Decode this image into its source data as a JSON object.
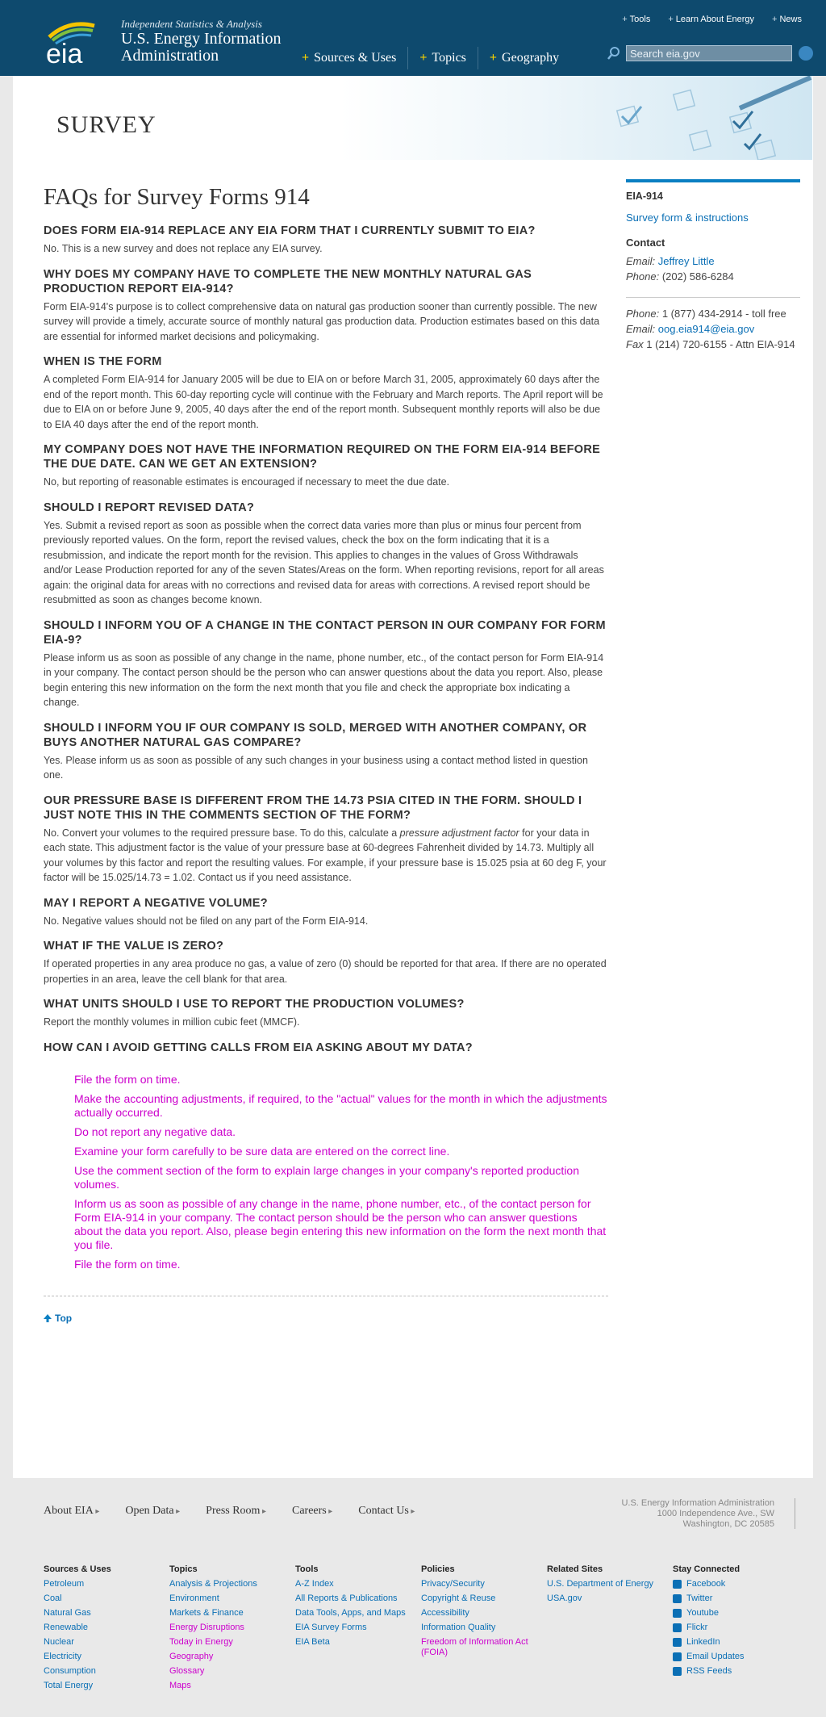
{
  "header": {
    "tagline": "Independent Statistics & Analysis",
    "agency_line1": "U.S. Energy Information",
    "agency_line2": "Administration",
    "logo_text": "eia",
    "utility": [
      "Tools",
      "Learn About Energy",
      "News"
    ],
    "nav": [
      "Sources & Uses",
      "Topics",
      "Geography"
    ],
    "search_placeholder": "Search eia.gov"
  },
  "banner": {
    "title": "SURVEY"
  },
  "page": {
    "title": "FAQs for Survey Forms 914",
    "faqs": [
      {
        "q": "DOES FORM EIA-914 REPLACE ANY EIA FORM THAT I CURRENTLY SUBMIT TO EIA?",
        "a": "No. This is a new survey and does not replace any EIA survey."
      },
      {
        "q": "WHY DOES MY COMPANY HAVE TO COMPLETE THE NEW MONTHLY NATURAL GAS PRODUCTION REPORT EIA-914?",
        "a": "Form EIA-914's purpose is to collect comprehensive data on natural gas production sooner than currently possible. The new survey will provide a timely, accurate source of monthly natural gas production data. Production estimates based on this data are essential for informed market decisions and policymaking."
      },
      {
        "q": "WHEN IS THE FORM",
        "a": "A completed Form EIA-914 for January 2005 will be due to EIA on or before March 31, 2005, approximately 60 days after the end of the report month. This 60-day reporting cycle will continue with the February and March reports. The April report will be due to EIA on or before June 9, 2005, 40 days after the end of the report month. Subsequent monthly reports will also be due to EIA 40 days after the end of the report month."
      },
      {
        "q": "MY COMPANY DOES NOT HAVE THE INFORMATION REQUIRED ON THE FORM EIA-914 BEFORE THE DUE DATE. CAN WE GET AN EXTENSION?",
        "a": "No, but reporting of reasonable estimates is encouraged if necessary to meet the due date."
      },
      {
        "q": "SHOULD I REPORT REVISED DATA?",
        "a": "Yes. Submit a revised report as soon as possible when the correct data varies more than plus or minus four percent from previously reported values. On the form, report the revised values, check the box on the form indicating that it is a resubmission, and indicate the report month for the revision. This applies to changes in the values of Gross Withdrawals and/or Lease Production reported for any of the seven States/Areas on the form. When reporting revisions, report for all areas again: the original data for areas with no corrections and revised data for areas with corrections. A revised report should be resubmitted as soon as changes become known."
      },
      {
        "q": "SHOULD I INFORM YOU OF A CHANGE IN THE CONTACT PERSON IN OUR COMPANY FOR FORM EIA-9?",
        "a": "Please inform us as soon as possible of any change in the name, phone number, etc., of the contact person for Form EIA-914 in your company. The contact person should be the person who can answer questions about the data you report. Also, please begin entering this new information on the form the next month that you file and check the appropriate box indicating a change."
      },
      {
        "q": "SHOULD I INFORM YOU IF OUR COMPANY IS SOLD, MERGED WITH ANOTHER COMPANY, OR BUYS ANOTHER NATURAL GAS COMPARE?",
        "a": "Yes. Please inform us as soon as possible of any such changes in your business using a contact method listed in question one."
      },
      {
        "q": "OUR PRESSURE BASE IS DIFFERENT FROM THE 14.73 PSIA CITED IN THE FORM. SHOULD I JUST NOTE THIS IN THE COMMENTS SECTION OF THE FORM?",
        "a_pre": "No. Convert your volumes to the required pressure base. To do this, calculate a ",
        "a_em": "pressure adjustment factor",
        "a_post": " for your data in each state. This adjustment factor is the value of your pressure base at 60-degrees Fahrenheit divided by 14.73. Multiply all your volumes by this factor and report the resulting values. For example, if your pressure base is 15.025 psia at 60 deg F, your factor will be 15.025/14.73 = 1.02. Contact us if you need assistance."
      },
      {
        "q": "MAY I REPORT A NEGATIVE VOLUME?",
        "a": "No. Negative values should not be filed on any part of the Form EIA-914."
      },
      {
        "q": "WHAT IF THE VALUE IS ZERO?",
        "a": "If operated properties in any area produce no gas, a value of zero (0) should be reported for that area. If there are no operated properties in an area, leave the cell blank for that area."
      },
      {
        "q": "WHAT UNITS SHOULD I USE TO REPORT THE PRODUCTION VOLUMES?",
        "a": "Report the monthly volumes in million cubic feet (MMCF)."
      },
      {
        "q": "HOW CAN I AVOID GETTING CALLS FROM EIA ASKING ABOUT MY DATA?",
        "a": ""
      }
    ],
    "tips": [
      "File the form on time.",
      "Make the accounting adjustments, if required, to the \"actual\" values for the month in which the adjustments actually occurred.",
      "Do not report any negative data.",
      "Examine your form carefully to be sure data are entered on the correct line.",
      "Use the comment section of the form to explain large changes in your company's reported production volumes.",
      "Inform us as soon as possible of any change in the name, phone number, etc., of the contact person for Form EIA-914 in your company. The contact person should be the person who can answer questions about the data you report. Also, please begin entering this new information on the form the next month that you file.",
      "File the form on time."
    ],
    "top_link": "Top"
  },
  "sidebar": {
    "heading": "EIA-914",
    "link": "Survey form & instructions",
    "contact_title": "Contact",
    "email_label": "Email:",
    "email_name": "Jeffrey Little",
    "phone_label": "Phone:",
    "phone": "(202) 586-6284",
    "phone2_label": "Phone:",
    "phone2": "1 (877) 434-2914 - toll free",
    "email2_label": "Email:",
    "email2": "oog.eia914@eia.gov",
    "fax_label": "Fax",
    "fax": "1 (214) 720-6155 - Attn EIA-914"
  },
  "footer": {
    "links": [
      "About EIA",
      "Open Data",
      "Press Room",
      "Careers",
      "Contact Us"
    ],
    "address": [
      "U.S. Energy Information Administration",
      "1000 Independence Ave., SW",
      "Washington, DC 20585"
    ],
    "columns": [
      {
        "title": "Sources & Uses",
        "items": [
          "Petroleum",
          "Coal",
          "Natural Gas",
          "Renewable",
          "Nuclear",
          "Electricity",
          "Consumption",
          "Total Energy"
        ]
      },
      {
        "title": "Topics",
        "items": [
          "Analysis & Projections",
          "Environment",
          "Markets & Finance",
          "Energy Disruptions",
          "Today in Energy",
          "Geography",
          "Glossary",
          "Maps"
        ]
      },
      {
        "title": "Tools",
        "items": [
          "A-Z Index",
          "All Reports & Publications",
          "Data Tools, Apps, and Maps",
          "EIA Survey Forms",
          "EIA Beta"
        ]
      },
      {
        "title": "Policies",
        "items": [
          "Privacy/Security",
          "Copyright & Reuse",
          "Accessibility",
          "Information Quality",
          "Freedom of Information Act (FOIA)"
        ]
      },
      {
        "title": "Related Sites",
        "items": [
          "U.S. Department of Energy",
          "USA.gov"
        ]
      },
      {
        "title": "Stay Connected",
        "items": [
          "Facebook",
          "Twitter",
          "Youtube",
          "Flickr",
          "LinkedIn",
          "Email Updates",
          "RSS Feeds"
        ]
      }
    ]
  },
  "colors": {
    "header_bg": "#0e4a6e",
    "accent": "#0a7fc2",
    "link": "#0a6fb5",
    "tip_magenta": "#cc00cc",
    "nav_star": "#f5d000"
  }
}
